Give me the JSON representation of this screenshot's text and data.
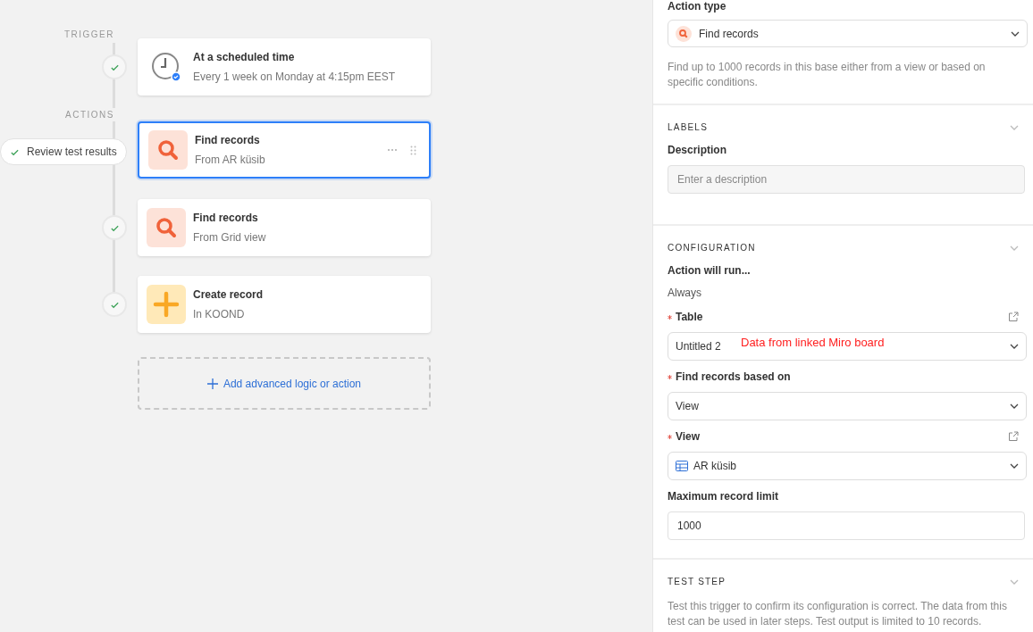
{
  "canvas": {
    "trigger_label": "TRIGGER",
    "actions_label": "ACTIONS",
    "review_button": "Review test results",
    "steps": [
      {
        "kind": "clock",
        "title": "At a scheduled time",
        "subtitle": "Every 1 week on Monday at 4:15pm EEST",
        "selected": false,
        "checked": true
      },
      {
        "kind": "search",
        "title": "Find records",
        "subtitle": "From AR küsib",
        "selected": true,
        "checked": false
      },
      {
        "kind": "search",
        "title": "Find records",
        "subtitle": "From Grid view",
        "selected": false,
        "checked": true
      },
      {
        "kind": "plus",
        "title": "Create record",
        "subtitle": "In KOOND",
        "selected": false,
        "checked": true
      }
    ],
    "add_button": "Add advanced logic or action"
  },
  "panel": {
    "action_type": {
      "label": "Action type",
      "value": "Find records"
    },
    "intro": "Find up to 1000 records in this base either from a view or based on specific conditions.",
    "sections": [
      {
        "title": "LABELS",
        "fields": [
          {
            "kind": "input",
            "label": "Description",
            "placeholder": "Enter a description"
          }
        ]
      },
      {
        "title": "CONFIGURATION",
        "fields": [
          {
            "kind": "static",
            "label": "Action will run...",
            "value": "Always"
          },
          {
            "kind": "select",
            "label": "Table",
            "value": "Untitled 2",
            "required": true,
            "external_link": true,
            "annotation": "Data from linked Miro board"
          },
          {
            "kind": "select",
            "label": "Find records based on",
            "value": "View",
            "required": true
          },
          {
            "kind": "view_select",
            "label": "View",
            "value": "AR küsib",
            "required": true,
            "external_link": true
          },
          {
            "kind": "input",
            "label": "Maximum record limit",
            "value": "1000"
          }
        ]
      },
      {
        "title": "TEST STEP",
        "text": "Test this trigger to confirm its configuration is correct. The data from this test can be used in later steps. Test output is limited to 10 records."
      }
    ]
  }
}
